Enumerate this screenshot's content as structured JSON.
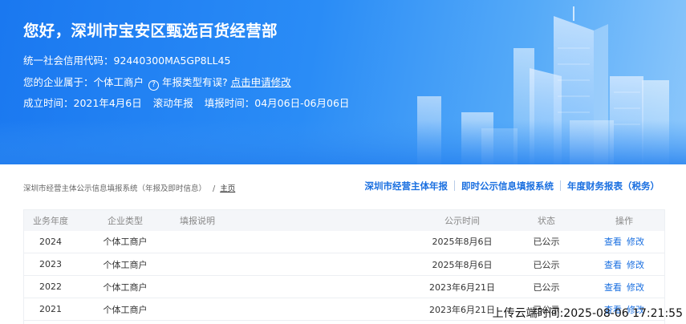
{
  "banner": {
    "company_name": "您好，深圳市宝安区甄选百货经营部",
    "credit_code_label": "统一社会信用代码：",
    "credit_code": "92440300MA5GP8LL45",
    "enterprise_type_label": "您的企业属于：",
    "enterprise_type": "个体工商户",
    "report_type_question": "年报类型有误?",
    "apply_modify": "点击申请修改",
    "established_label": "成立时间：",
    "established_date": "2021年4月6日",
    "rolling_report": "滚动年报",
    "fill_period_label": "填报时间：",
    "fill_period": "04月06日-06月06日",
    "colors": {
      "banner_start": "#1a78f0",
      "banner_end": "#8cc7fb"
    }
  },
  "breadcrumb": {
    "system": "深圳市经营主体公示信息填报系统（年报及即时信息）",
    "separator": "/",
    "home": "主页"
  },
  "top_links": [
    {
      "label": "深圳市经营主体年报"
    },
    {
      "label": "即时公示信息填报系统"
    },
    {
      "label": "年度财务报表（税务）"
    }
  ],
  "table": {
    "headers": {
      "year": "业务年度",
      "type": "企业类型",
      "desc": "填报说明",
      "date": "公示时间",
      "status": "状态",
      "action": "操作"
    },
    "rows": [
      {
        "year": "2024",
        "type": "个体工商户",
        "desc": "",
        "date": "2025年8月6日",
        "status": "已公示",
        "view": "查看",
        "edit": "修改"
      },
      {
        "year": "2023",
        "type": "个体工商户",
        "desc": "",
        "date": "2025年8月6日",
        "status": "已公示",
        "view": "查看",
        "edit": "修改"
      },
      {
        "year": "2022",
        "type": "个体工商户",
        "desc": "",
        "date": "2023年6月21日",
        "status": "已公示",
        "view": "查看",
        "edit": "修改"
      },
      {
        "year": "2021",
        "type": "个体工商户",
        "desc": "",
        "date": "2023年6月21日",
        "status": "已公示",
        "view": "查看",
        "edit": "修改"
      }
    ]
  },
  "overlay": {
    "upload_time": "上传云端时间:2025-08-06 17:21:55"
  }
}
